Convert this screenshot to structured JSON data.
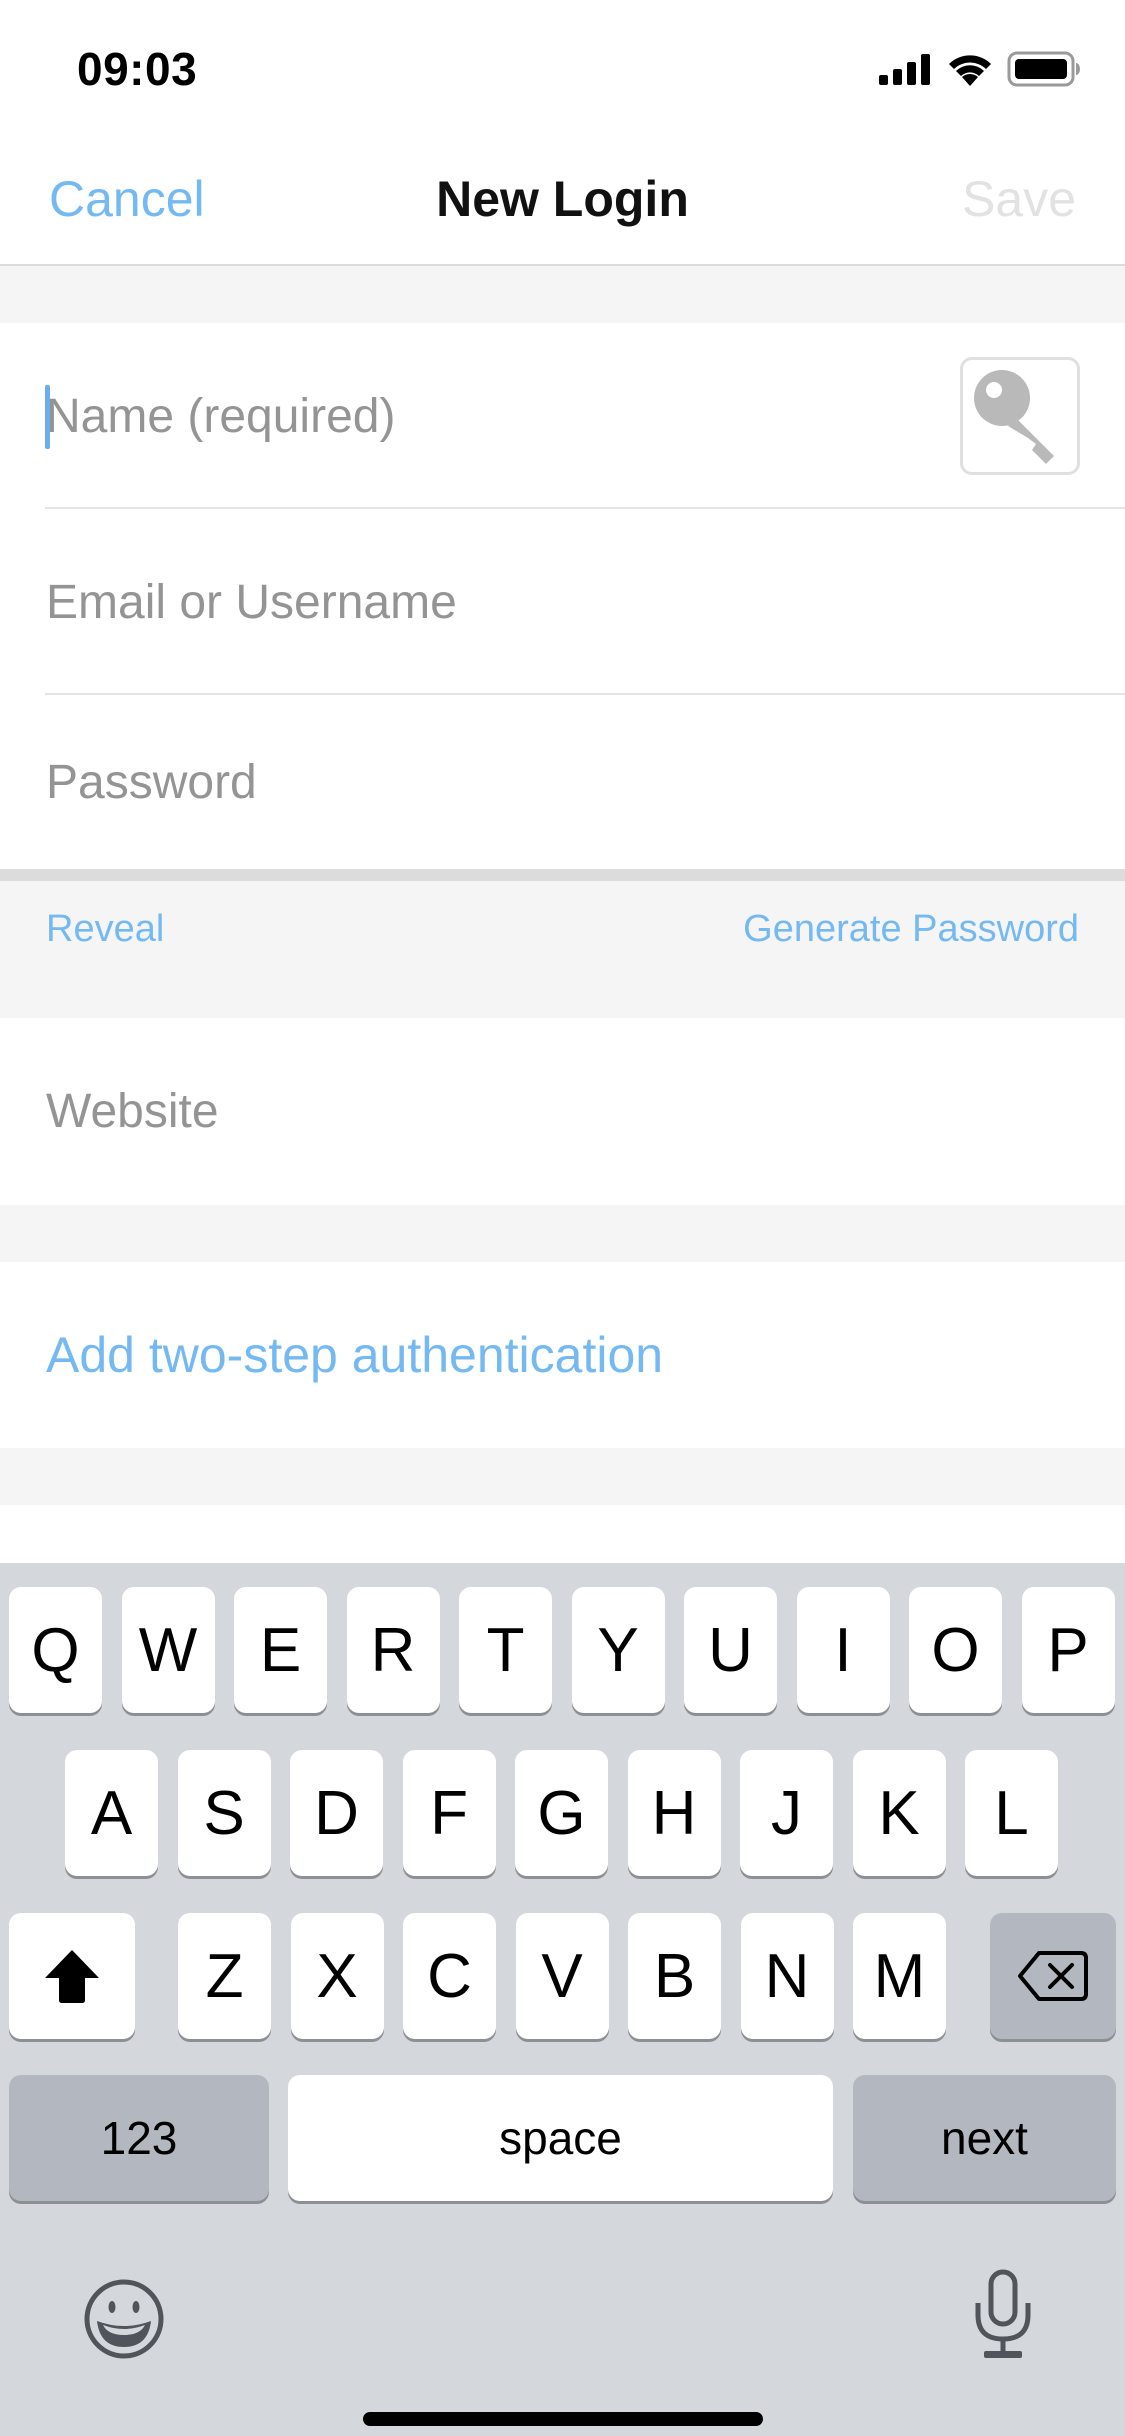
{
  "status_bar": {
    "time": "09:03",
    "icons": [
      "cellular-signal-icon",
      "wifi-icon",
      "battery-icon"
    ]
  },
  "nav": {
    "cancel_label": "Cancel",
    "title": "New Login",
    "save_label": "Save"
  },
  "form": {
    "name": {
      "placeholder": "Name (required)",
      "value": ""
    },
    "email": {
      "placeholder": "Email or Username",
      "value": ""
    },
    "password": {
      "placeholder": "Password",
      "value": ""
    },
    "reveal_label": "Reveal",
    "generate_label": "Generate Password",
    "website": {
      "placeholder": "Website",
      "value": ""
    },
    "two_step_label": "Add two-step authentication",
    "key_icon": "key-icon"
  },
  "keyboard": {
    "row1": [
      "Q",
      "W",
      "E",
      "R",
      "T",
      "Y",
      "U",
      "I",
      "O",
      "P"
    ],
    "row2": [
      "A",
      "S",
      "D",
      "F",
      "G",
      "H",
      "J",
      "K",
      "L"
    ],
    "row3": [
      "Z",
      "X",
      "C",
      "V",
      "B",
      "N",
      "M"
    ],
    "numbers_label": "123",
    "space_label": "space",
    "next_label": "next",
    "shift_icon": "shift-icon",
    "delete_icon": "backspace-icon",
    "emoji_icon": "emoji-icon",
    "mic_icon": "microphone-icon"
  },
  "colors": {
    "accent": "#74b9f2",
    "placeholder": "#949494",
    "disabled": "#e2e2e2",
    "keyboard_bg": "#d4d7dc",
    "key_dark": "#b3b7bf"
  }
}
